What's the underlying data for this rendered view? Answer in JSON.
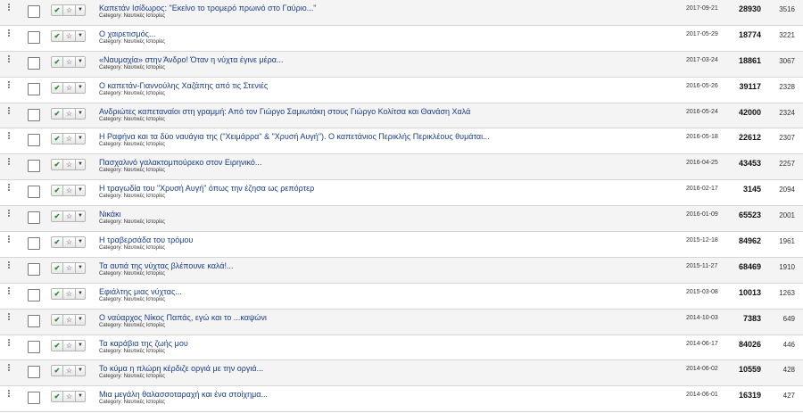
{
  "rows": [
    {
      "title": "Καπετάν Ισίδωρος: \"Εκείνο το τρομερό πρωινό στο Γαύριο...\"",
      "category": "Category: Ναυτικές Ιστορίες",
      "date": "2017-09-21",
      "hits": "28930",
      "id": "3516"
    },
    {
      "title": "Ο χαιρετισμός...",
      "category": "Category: Ναυτικές Ιστορίες",
      "date": "2017-05-29",
      "hits": "18774",
      "id": "3221"
    },
    {
      "title": "«Ναυμαχία» στην Άνδρο! Όταν η νύχτα έγινε μέρα...",
      "category": "Category: Ναυτικές Ιστορίες",
      "date": "2017-03-24",
      "hits": "18861",
      "id": "3067"
    },
    {
      "title": "Ο καπετάν-Γιαννούλης Χαζάπης από τις Στενιές",
      "category": "Category: Ναυτικές Ιστορίες",
      "date": "2016-05-26",
      "hits": "39117",
      "id": "2328"
    },
    {
      "title": "Ανδριώτες καπεταναίοι στη γραμμή: Από τον Γιώργο Σαμιωτάκη στους Γιώργο Κολίτσα και Θανάση Χαλά",
      "category": "Category: Ναυτικές Ιστορίες",
      "date": "2016-05-24",
      "hits": "42000",
      "id": "2324"
    },
    {
      "title": "Η Ραφήνα και τα δύο ναυάγια της (\"Χειμάρρα\" & \"Χρυσή Αυγή\"). Ο καπετάνιος Περικλής Περικλέους θυμάται...",
      "category": "Category: Ναυτικές Ιστορίες",
      "date": "2016-05-18",
      "hits": "22612",
      "id": "2307"
    },
    {
      "title": "Πασχαλινό γαλακτομπούρεκο στον Ειρηνικό...",
      "category": "Category: Ναυτικές Ιστορίες",
      "date": "2016-04-25",
      "hits": "43453",
      "id": "2257"
    },
    {
      "title": "Η τραγωδία του \"Χρυσή Αυγή\" όπως την έζησα ως ρεπόρτερ",
      "category": "Category: Ναυτικές Ιστορίες",
      "date": "2016-02-17",
      "hits": "3145",
      "id": "2094"
    },
    {
      "title": "Νικάκι",
      "category": "Category: Ναυτικές Ιστορίες",
      "date": "2016-01-09",
      "hits": "65523",
      "id": "2001"
    },
    {
      "title": "Η τραβερσάδα του τρόμου",
      "category": "Category: Ναυτικές Ιστορίες",
      "date": "2015-12-18",
      "hits": "84962",
      "id": "1961"
    },
    {
      "title": "Τα αυτιά της νύχτας βλέπουνε καλά!...",
      "category": "Category: Ναυτικές Ιστορίες",
      "date": "2015-11-27",
      "hits": "68469",
      "id": "1910"
    },
    {
      "title": "Εφιάλτης μιας νύχτας...",
      "category": "Category: Ναυτικές Ιστορίες",
      "date": "2015-03-08",
      "hits": "10013",
      "id": "1263"
    },
    {
      "title": "Ο ναύαρχος Νίκος Παπάς, εγώ και το ...καψώνι",
      "category": "Category: Ναυτικές Ιστορίες",
      "date": "2014-10-03",
      "hits": "7383",
      "id": "649"
    },
    {
      "title": "Τα καράβια της ζωής μου",
      "category": "Category: Ναυτικές Ιστορίες",
      "date": "2014-06-17",
      "hits": "84026",
      "id": "446"
    },
    {
      "title": "Το κύμα η πλώρη κέρδιζε οργιά με την οργιά...",
      "category": "Category: Ναυτικές Ιστορίες",
      "date": "2014-06-02",
      "hits": "10559",
      "id": "428"
    },
    {
      "title": "Μια μεγάλη θαλασσοταραχή και ένα στοίχημα...",
      "category": "Category: Ναυτικές Ιστορίες",
      "date": "2014-06-01",
      "hits": "16319",
      "id": "427"
    }
  ],
  "icons": {
    "drag": "drag-handle-icon",
    "publish": "check-icon",
    "feature": "star-icon",
    "actions": "caret-down-icon"
  }
}
